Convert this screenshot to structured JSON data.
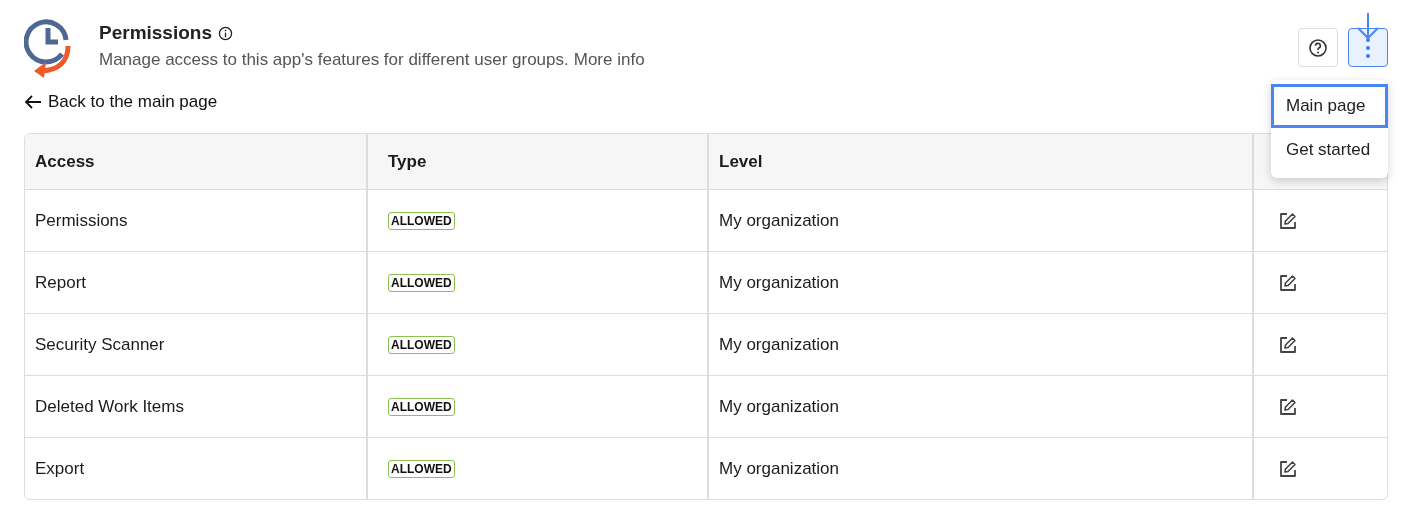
{
  "header": {
    "title": "Permissions",
    "description": "Manage access to this app's features for different user groups.",
    "more_info": "More info"
  },
  "back_link": "Back to the main page",
  "menu": {
    "items": [
      {
        "label": "Main page",
        "selected": true
      },
      {
        "label": "Get started",
        "selected": false
      }
    ]
  },
  "table": {
    "columns": [
      "Access",
      "Type",
      "Level"
    ],
    "rows": [
      {
        "access": "Permissions",
        "type": "ALLOWED",
        "level": "My organization"
      },
      {
        "access": "Report",
        "type": "ALLOWED",
        "level": "My organization"
      },
      {
        "access": "Security Scanner",
        "type": "ALLOWED",
        "level": "My organization"
      },
      {
        "access": "Deleted Work Items",
        "type": "ALLOWED",
        "level": "My organization"
      },
      {
        "access": "Export",
        "type": "ALLOWED",
        "level": "My organization"
      }
    ]
  }
}
